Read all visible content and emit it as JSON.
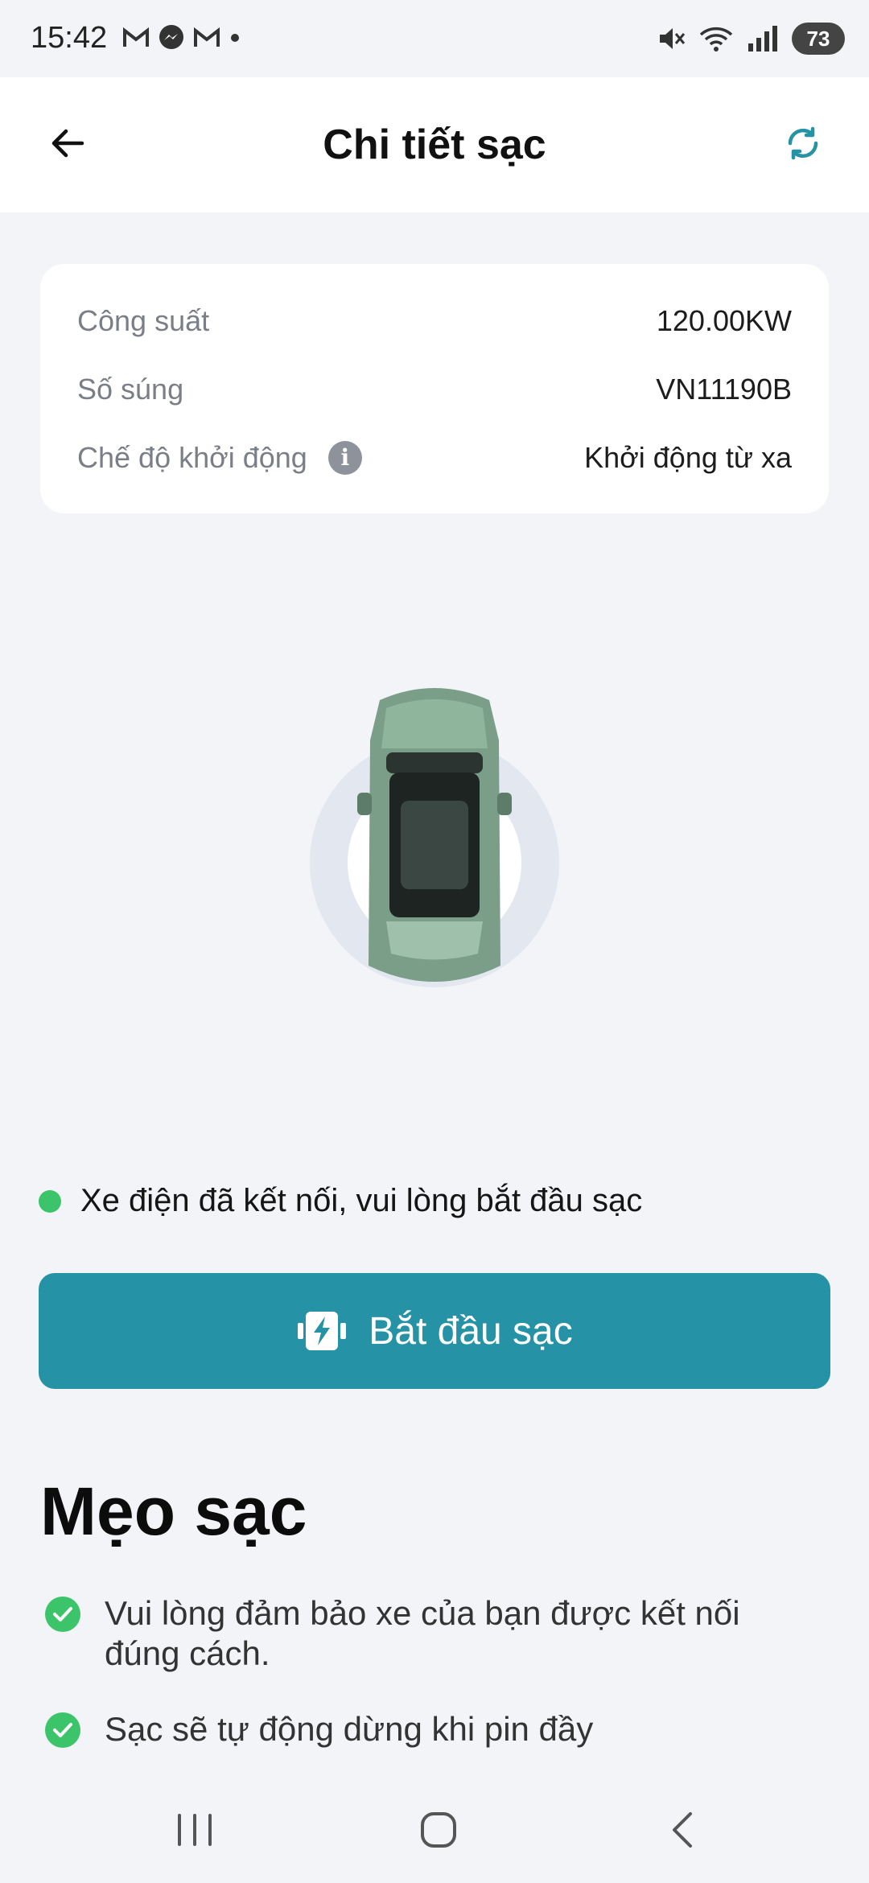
{
  "status_bar": {
    "time": "15:42",
    "left_icons": [
      "gmail-icon",
      "messenger-icon",
      "gmail-icon",
      "dot-icon"
    ],
    "right_icons": [
      "mute-icon",
      "wifi-icon",
      "signal-icon"
    ],
    "battery": "73"
  },
  "header": {
    "title": "Chi tiết sạc"
  },
  "info_card": {
    "rows": [
      {
        "label": "Công suất",
        "value": "120.00KW"
      },
      {
        "label": "Số súng",
        "value": "VN11190B"
      },
      {
        "label": "Chế độ khởi động",
        "value": "Khởi động từ xa"
      }
    ]
  },
  "connection_status": {
    "text": "Xe điện đã kết nối, vui lòng bắt đầu sạc",
    "color": "#3cc46a"
  },
  "start_button": {
    "label": "Bắt đầu sạc",
    "color": "#2592a6"
  },
  "tips": {
    "title": "Mẹo sạc",
    "items": [
      "Vui lòng đảm bảo xe của bạn được kết nối đúng cách.",
      "Sạc sẽ tự động dừng khi pin đầy"
    ]
  },
  "colors": {
    "accent": "#2592a6",
    "success": "#3cc46a",
    "background": "#f2f4f8"
  }
}
